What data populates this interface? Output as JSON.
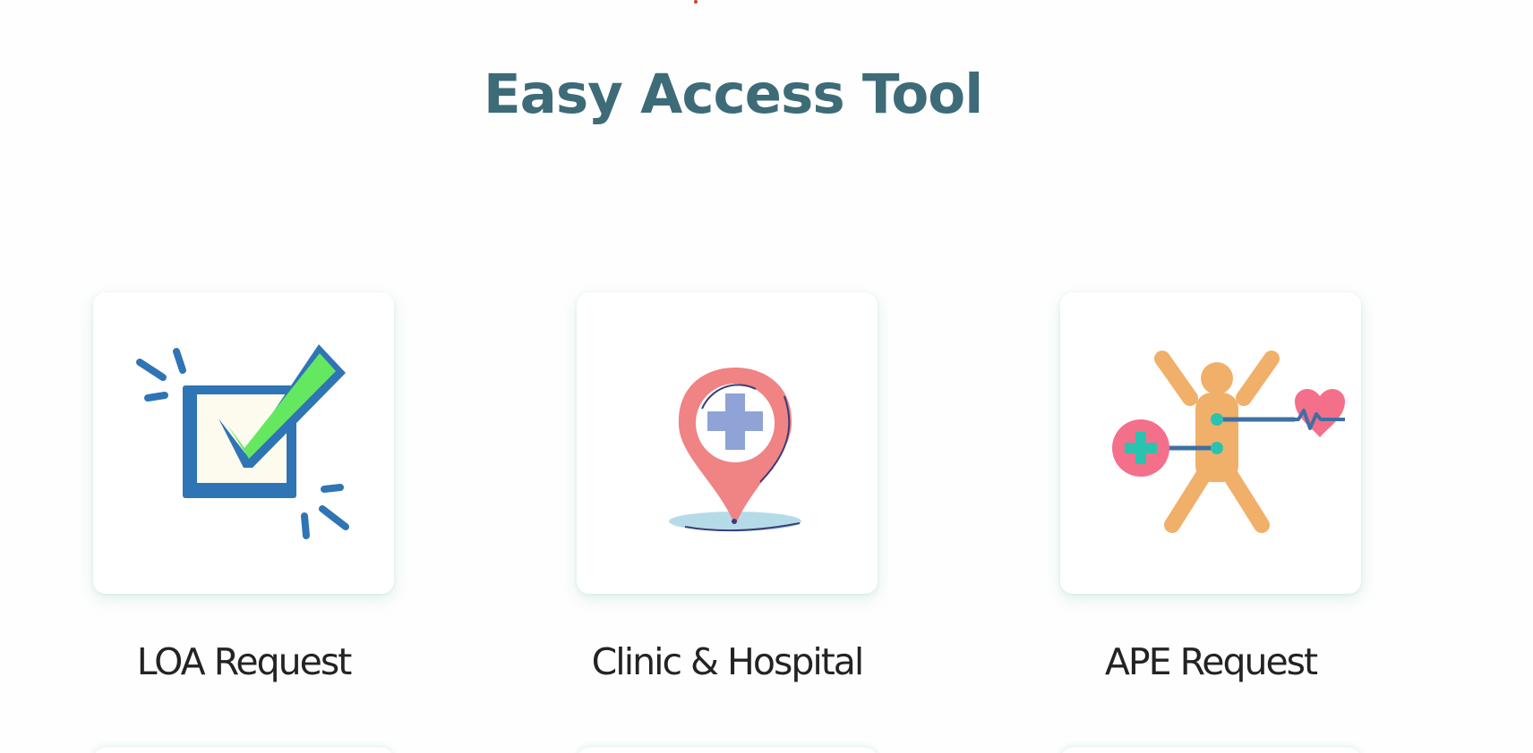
{
  "section": {
    "title": "Easy Access Tool"
  },
  "tools": [
    {
      "label": "LOA Request",
      "icon": "checkbox-check-icon"
    },
    {
      "label": "Clinic & Hospital",
      "icon": "location-pin-medical-icon"
    },
    {
      "label": "APE Request",
      "icon": "health-person-icon"
    }
  ],
  "colors": {
    "title": "#3e6b78",
    "label": "#232323",
    "check_blue": "#2f74b5",
    "check_green": "#64e85f",
    "pin_red": "#f08383",
    "cross_lavender": "#8fa3d6",
    "body_orange": "#f0b06a",
    "heart_pink": "#f46f8a",
    "teal": "#2ac3b0"
  }
}
